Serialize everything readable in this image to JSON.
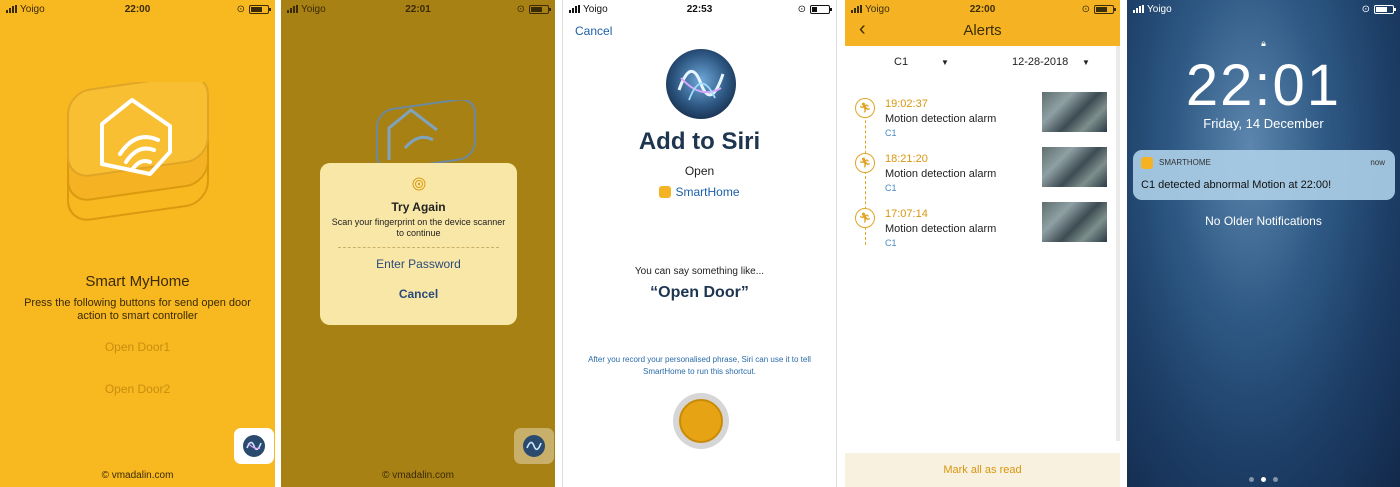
{
  "screens": {
    "home": {
      "status": {
        "carrier": "Yoigo",
        "time": "22:00"
      },
      "title": "Smart MyHome",
      "description": "Press the following buttons for send open door action to smart controller",
      "buttons": [
        "Open Door1",
        "Open Door2"
      ],
      "footer": "© vmadalin.com"
    },
    "fingerprint": {
      "status": {
        "carrier": "Yoigo",
        "time": "22:01"
      },
      "dialog": {
        "title": "Try Again",
        "message": "Scan your fingerprint on the device scanner to continue",
        "primary": "Enter Password",
        "cancel": "Cancel"
      },
      "footer": "© vmadalin.com"
    },
    "siri": {
      "status": {
        "carrier": "Yoigo",
        "time": "22:53"
      },
      "cancel": "Cancel",
      "title": "Add to Siri",
      "action": "Open",
      "app_name": "SmartHome",
      "say_hint": "You can say something like...",
      "phrase": "“Open Door”",
      "note": "After you record your personalised phrase, Siri can use it to tell SmartHome to run this shortcut."
    },
    "alerts": {
      "status": {
        "carrier": "Yoigo",
        "time": "22:00"
      },
      "title": "Alerts",
      "back_icon": "chevron-left-icon",
      "filters": {
        "camera": "C1",
        "date": "12-28-2018"
      },
      "items": [
        {
          "time": "19:02:37",
          "message": "Motion detection alarm",
          "camera": "C1"
        },
        {
          "time": "18:21:20",
          "message": "Motion detection alarm",
          "camera": "C1"
        },
        {
          "time": "17:07:14",
          "message": "Motion detection alarm",
          "camera": "C1"
        }
      ],
      "mark_all": "Mark all as read"
    },
    "lockscreen": {
      "status": {
        "carrier": "Yoigo",
        "time": ""
      },
      "clock": "22:01",
      "date": "Friday, 14 December",
      "notification": {
        "app": "SMARTHOME",
        "when": "now",
        "message": "C1 detected abnormal Motion at 22:00!"
      },
      "older": "No Older Notifications"
    }
  },
  "colors": {
    "brand_yellow": "#f5b323",
    "dim_yellow": "#a88114",
    "link_blue": "#1d5fa8",
    "dark_navy": "#1e3550"
  }
}
